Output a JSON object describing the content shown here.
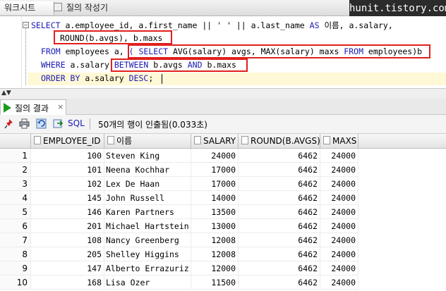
{
  "tabs": [
    {
      "label": "워크시트"
    },
    {
      "label": "질의 작성기"
    }
  ],
  "watermark": "hunit.tistory.com",
  "editor": {
    "lines": [
      {
        "kw1": "SELECT",
        "rest": " a.employee_id, a.first_name || ' ' || a.last_name ",
        "kw2": "AS",
        "rest2": " 이름, a.salary,"
      },
      {
        "text": "ROUND(b.avgs), b.maxs"
      },
      {
        "kw1": "FROM",
        "rest": " employees a, ",
        "sub_open": "( ",
        "kw_sel": "SELECT",
        "sub_mid": " AVG(salary) avgs, MAX(salary) maxs ",
        "kw_from": "FROM",
        "sub_end": " employees)b"
      },
      {
        "kw1": "WHERE",
        "rest": " a.salary ",
        "kw_between": "BETWEEN",
        "mid": " b.avgs ",
        "kw_and": "AND",
        "end": " b.maxs"
      },
      {
        "kw1": "ORDER BY",
        "rest": " a.salary ",
        "kw_desc": "DESC",
        "end": ";"
      }
    ]
  },
  "results_tab": {
    "label": "질의 결과",
    "close": "×"
  },
  "toolbar": {
    "sql_label": "SQL",
    "status": "50개의 행이 인출됨(0.033초)"
  },
  "grid": {
    "columns": [
      "EMPLOYEE_ID",
      "이름",
      "SALARY",
      "ROUND(B.AVGS)",
      "MAXS"
    ],
    "rows": [
      {
        "n": "1",
        "id": "100",
        "name": "Steven King",
        "salary": "24000",
        "avg": "6462",
        "max": "24000"
      },
      {
        "n": "2",
        "id": "101",
        "name": "Neena Kochhar",
        "salary": "17000",
        "avg": "6462",
        "max": "24000"
      },
      {
        "n": "3",
        "id": "102",
        "name": "Lex De Haan",
        "salary": "17000",
        "avg": "6462",
        "max": "24000"
      },
      {
        "n": "4",
        "id": "145",
        "name": "John Russell",
        "salary": "14000",
        "avg": "6462",
        "max": "24000"
      },
      {
        "n": "5",
        "id": "146",
        "name": "Karen Partners",
        "salary": "13500",
        "avg": "6462",
        "max": "24000"
      },
      {
        "n": "6",
        "id": "201",
        "name": "Michael Hartstein",
        "salary": "13000",
        "avg": "6462",
        "max": "24000"
      },
      {
        "n": "7",
        "id": "108",
        "name": "Nancy Greenberg",
        "salary": "12008",
        "avg": "6462",
        "max": "24000"
      },
      {
        "n": "8",
        "id": "205",
        "name": "Shelley Higgins",
        "salary": "12008",
        "avg": "6462",
        "max": "24000"
      },
      {
        "n": "9",
        "id": "147",
        "name": "Alberto Errazuriz",
        "salary": "12000",
        "avg": "6462",
        "max": "24000"
      },
      {
        "n": "10",
        "id": "168",
        "name": "Lisa Ozer",
        "salary": "11500",
        "avg": "6462",
        "max": "24000"
      }
    ]
  }
}
